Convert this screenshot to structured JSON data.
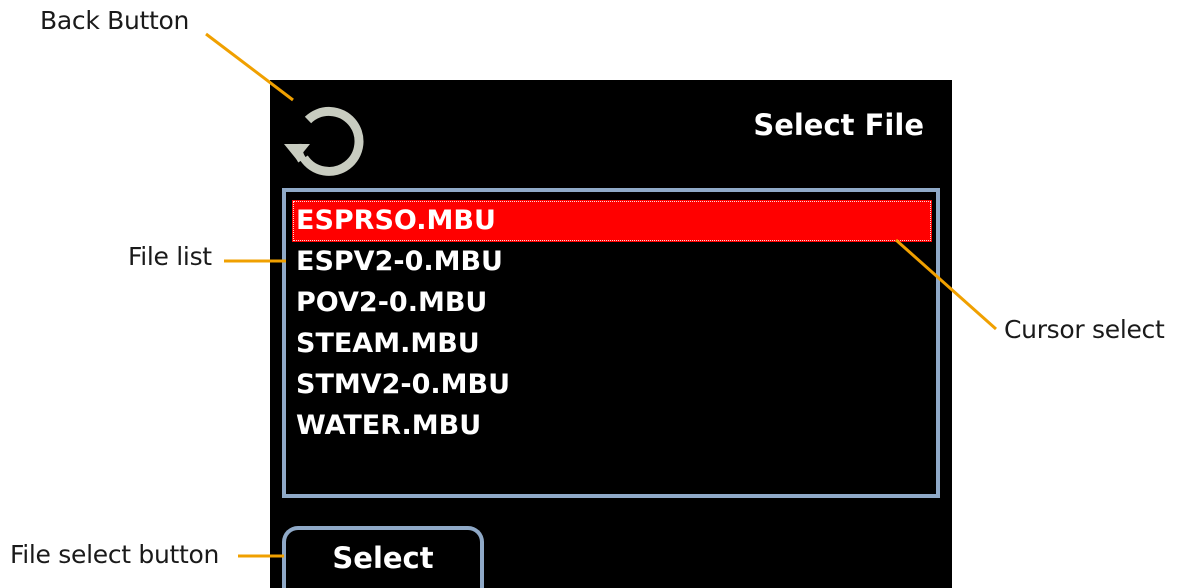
{
  "callouts": {
    "back_button": "Back Button",
    "file_list": "File list",
    "cursor_select": "Cursor select",
    "file_select_button": "File select button"
  },
  "colors": {
    "callout_line": "#f0a000",
    "screen_bg": "#000000",
    "list_border": "#8fa9c7",
    "cursor": "#ff0000",
    "back_icon": "#c8ccc0"
  },
  "screen": {
    "title": "Select File",
    "back_icon": "back-arrow-icon",
    "files": [
      {
        "name": "ESPRSO.MBU",
        "selected": true
      },
      {
        "name": "ESPV2-0.MBU",
        "selected": false
      },
      {
        "name": "POV2-0.MBU",
        "selected": false
      },
      {
        "name": "STEAM.MBU",
        "selected": false
      },
      {
        "name": "STMV2-0.MBU",
        "selected": false
      },
      {
        "name": "WATER.MBU",
        "selected": false
      }
    ],
    "select_label": "Select"
  }
}
